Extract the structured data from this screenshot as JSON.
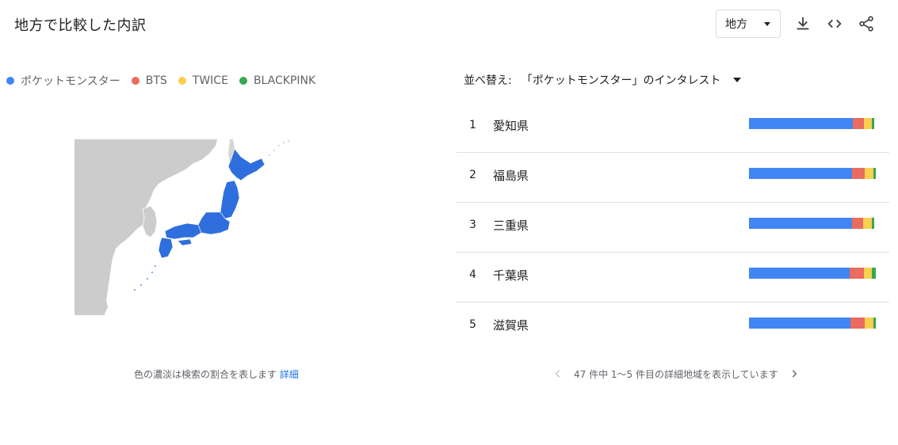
{
  "header": {
    "title": "地方で比較した内訳"
  },
  "toolbar": {
    "region_label": "地方",
    "icons": [
      "download-icon",
      "embed-code-icon",
      "share-icon"
    ]
  },
  "legend": [
    {
      "label": "ポケットモンスター",
      "color": "#4285f4"
    },
    {
      "label": "BTS",
      "color": "#ea6b5f"
    },
    {
      "label": "TWICE",
      "color": "#fbcf4f"
    },
    {
      "label": "BLACKPINK",
      "color": "#34a853"
    }
  ],
  "map": {
    "caption": "色の濃淡は検索の割合を表します",
    "caption_link": "詳細",
    "highlight_color": "#2f6fdd",
    "land_color": "#cccccc"
  },
  "sort": {
    "label": "並べ替え:",
    "value": "「ポケットモンスター」のインタレスト"
  },
  "ranking": [
    {
      "rank": "1",
      "name": "愛知県",
      "shares": [
        0.82,
        0.09,
        0.06,
        0.02
      ]
    },
    {
      "rank": "2",
      "name": "福島県",
      "shares": [
        0.81,
        0.1,
        0.07,
        0.02
      ]
    },
    {
      "rank": "3",
      "name": "三重県",
      "shares": [
        0.81,
        0.09,
        0.07,
        0.02
      ]
    },
    {
      "rank": "4",
      "name": "千葉県",
      "shares": [
        0.8,
        0.11,
        0.06,
        0.03
      ]
    },
    {
      "rank": "5",
      "name": "滋賀県",
      "shares": [
        0.8,
        0.11,
        0.07,
        0.02
      ]
    }
  ],
  "pager": {
    "text": "47 件中 1～5 件目の詳細地域を表示しています"
  }
}
